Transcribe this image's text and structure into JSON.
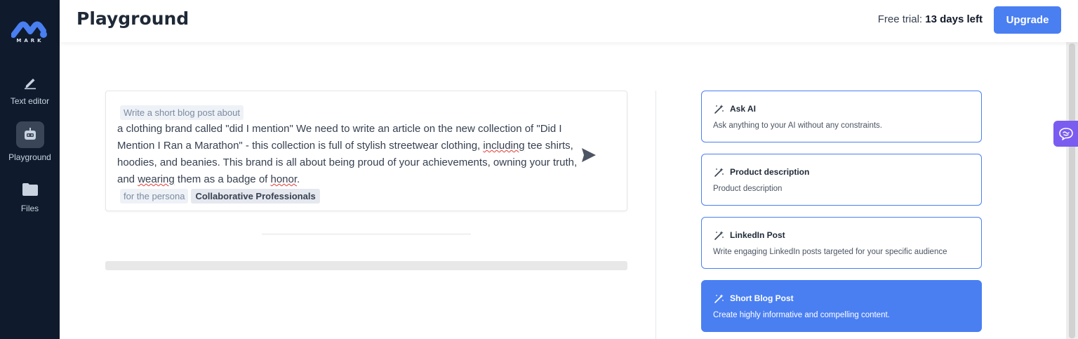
{
  "sidebar": {
    "logo_text": "MARK",
    "items": [
      {
        "label": "Text editor",
        "icon": "pencil-icon"
      },
      {
        "label": "Playground",
        "icon": "robot-icon",
        "active": true
      },
      {
        "label": "Files",
        "icon": "folder-icon"
      }
    ]
  },
  "header": {
    "title": "Playground",
    "trial_prefix": "Free trial:",
    "trial_days": "13 days left",
    "upgrade_label": "Upgrade"
  },
  "prompt": {
    "prefix_chip": "Write a short blog post about",
    "text_parts": [
      "a clothing brand called \"did I mention\" We need to write an article on the new collection of \"Did I Mention I Ran a Marathon\" - this collection is full of stylish streetwear clothing, ",
      "including",
      " tee shirts, hoodies, and beanies. This brand is all about being proud of your achievements, owning your truth, and ",
      "wearing",
      " them as a badge of ",
      "honor",
      "."
    ],
    "persona_label": "for the persona",
    "persona_value": "Collaborative Professionals"
  },
  "templates": [
    {
      "title": "Ask AI",
      "description": "Ask anything to your AI without any constraints.",
      "selected": false
    },
    {
      "title": "Product description",
      "description": "Product description",
      "selected": false
    },
    {
      "title": "LinkedIn Post",
      "description": "Write engaging LinkedIn posts targeted for your specific audience",
      "selected": false
    },
    {
      "title": "Short Blog Post",
      "description": "Create highly informative and compelling content.",
      "selected": true
    }
  ],
  "colors": {
    "sidebar_bg": "#0f1b2d",
    "accent": "#4a7ff2",
    "chat_widget": "#7b5cf0"
  }
}
